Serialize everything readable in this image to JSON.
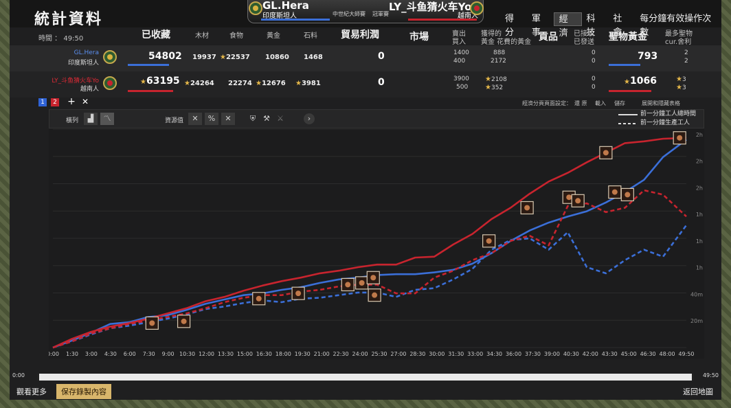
{
  "title": "統計資料",
  "match": {
    "player1": {
      "name": "GL.Hera",
      "civ": "印度斯坦人"
    },
    "player2": {
      "name": "LY_斗鱼猜火车Yo",
      "civ": "越南人"
    },
    "event": "中世紀大師賽",
    "event2": "冠軍賽"
  },
  "tabs": [
    "得分",
    "軍事",
    "經濟",
    "科技",
    "社會",
    "每分鐘有效操作次數"
  ],
  "header": {
    "time_label": "時間 ： 49:50",
    "collected": "已收藏",
    "wood": "木材",
    "food": "食物",
    "gold": "黃金",
    "stone": "石料",
    "trade_profit": "貿易利潤",
    "market": "市場",
    "sell_buy": [
      "賣出",
      "買入"
    ],
    "gained": [
      "獲得的",
      "黃金 花費的黃金"
    ],
    "tribute": "貢品",
    "received_sent": [
      "已接收",
      "已發送"
    ],
    "relic_gold": "聖物黃金",
    "most_relics": [
      "最多聖物",
      "cur.舍利"
    ]
  },
  "rows": [
    {
      "name": "GL.Hera",
      "civ": "印度斯坦人",
      "total": "54802",
      "wood": "19937",
      "food": "22537",
      "gold": "10860",
      "stone": "1468",
      "trade": "0",
      "sell": "1400",
      "buy": "400",
      "gained": "888",
      "spent": "2172",
      "recv": "0",
      "sent": "0",
      "relic_gold": "793",
      "relics_a": "2",
      "relics_b": "2"
    },
    {
      "name": "LY_斗鱼猜火车Yo",
      "civ": "越南人",
      "total": "63195",
      "wood": "24264",
      "food": "22274",
      "gold": "12676",
      "stone": "3981",
      "trade": "0",
      "sell": "3900",
      "buy": "500",
      "gained": "2108",
      "spent": "352",
      "recv": "0",
      "sent": "0",
      "relic_gold": "1066",
      "relics_a": "3",
      "relics_b": "3"
    }
  ],
  "controls": {
    "filter_label": "橫列",
    "resource_label": "資源值",
    "settings_label": "經濟分頁頁面設定：",
    "tools": [
      "還 原",
      "載入",
      "儲存"
    ],
    "expand": "展開和隱藏表格"
  },
  "legend": [
    "前一分鐘工人總時間",
    "前一分鐘生產工人"
  ],
  "timeline": {
    "start": "0:00",
    "end": "49:50"
  },
  "bottom": {
    "more": "觀看更多",
    "save": "保存錄製內容",
    "back": "返回地圖"
  },
  "colors": {
    "p1": "#3b6fd8",
    "p2": "#c8242e"
  },
  "chart_data": {
    "type": "line",
    "x_ticks": [
      "0:00",
      "1:30",
      "3:00",
      "4:30",
      "6:00",
      "7:30",
      "9:00",
      "10:30",
      "12:00",
      "13:30",
      "15:00",
      "16:30",
      "18:00",
      "19:30",
      "21:00",
      "22:30",
      "24:00",
      "25:30",
      "27:00",
      "28:30",
      "30:00",
      "31:30",
      "33:00",
      "34:30",
      "36:00",
      "37:30",
      "39:00",
      "40:30",
      "42:00",
      "43:30",
      "45:00",
      "46:30",
      "48:00",
      "49:50"
    ],
    "y_ticks": [
      "20m",
      "40m",
      "1h",
      "1h",
      "1h",
      "2h",
      "2h",
      "2h"
    ],
    "x": [
      0,
      1.5,
      3,
      4.5,
      6,
      7.5,
      9,
      10.5,
      12,
      13.5,
      15,
      16.5,
      18,
      19.5,
      21,
      22.5,
      24,
      25.5,
      27,
      28.5,
      30,
      31.5,
      33,
      34.5,
      36,
      37.5,
      39,
      40.5,
      42,
      43.5,
      45,
      46.5,
      48,
      49.83
    ],
    "series": [
      {
        "name": "GL.Hera 前一分鐘工人總時間",
        "color": "#3b6fd8",
        "style": "solid",
        "values": [
          0,
          8,
          17,
          27,
          29,
          35,
          37,
          43,
          50,
          55,
          60,
          62,
          66,
          69,
          74,
          78,
          80,
          83,
          84,
          84,
          86,
          89,
          96,
          108,
          122,
          134,
          143,
          150,
          156,
          166,
          178,
          192,
          218,
          238
        ]
      },
      {
        "name": "LY_斗鱼猜火车Yo 前一分鐘工人總時間",
        "color": "#c8242e",
        "style": "solid",
        "values": [
          0,
          10,
          18,
          24,
          28,
          33,
          39,
          45,
          53,
          58,
          65,
          71,
          76,
          80,
          85,
          88,
          92,
          95,
          95,
          103,
          104,
          118,
          130,
          147,
          160,
          176,
          190,
          200,
          212,
          223,
          234,
          236,
          239,
          240
        ]
      },
      {
        "name": "GL.Hera 前一分鐘生產工人",
        "color": "#3b6fd8",
        "style": "dashed",
        "values": [
          0,
          7,
          15,
          22,
          25,
          29,
          33,
          38,
          44,
          47,
          51,
          54,
          52,
          56,
          57,
          60,
          63,
          63,
          58,
          66,
          68,
          78,
          90,
          112,
          123,
          125,
          112,
          132,
          92,
          85,
          100,
          112,
          104,
          140
        ]
      },
      {
        "name": "LY_斗鱼猜火车Yo 前一分鐘生產工人",
        "color": "#c8242e",
        "style": "dashed",
        "values": [
          0,
          7,
          16,
          22,
          27,
          31,
          35,
          39,
          45,
          52,
          57,
          60,
          60,
          64,
          66,
          70,
          72,
          72,
          62,
          62,
          80,
          88,
          100,
          108,
          122,
          128,
          117,
          162,
          165,
          155,
          160,
          180,
          175,
          150
        ]
      }
    ],
    "ylim": [
      0,
      250
    ],
    "grid": true
  }
}
